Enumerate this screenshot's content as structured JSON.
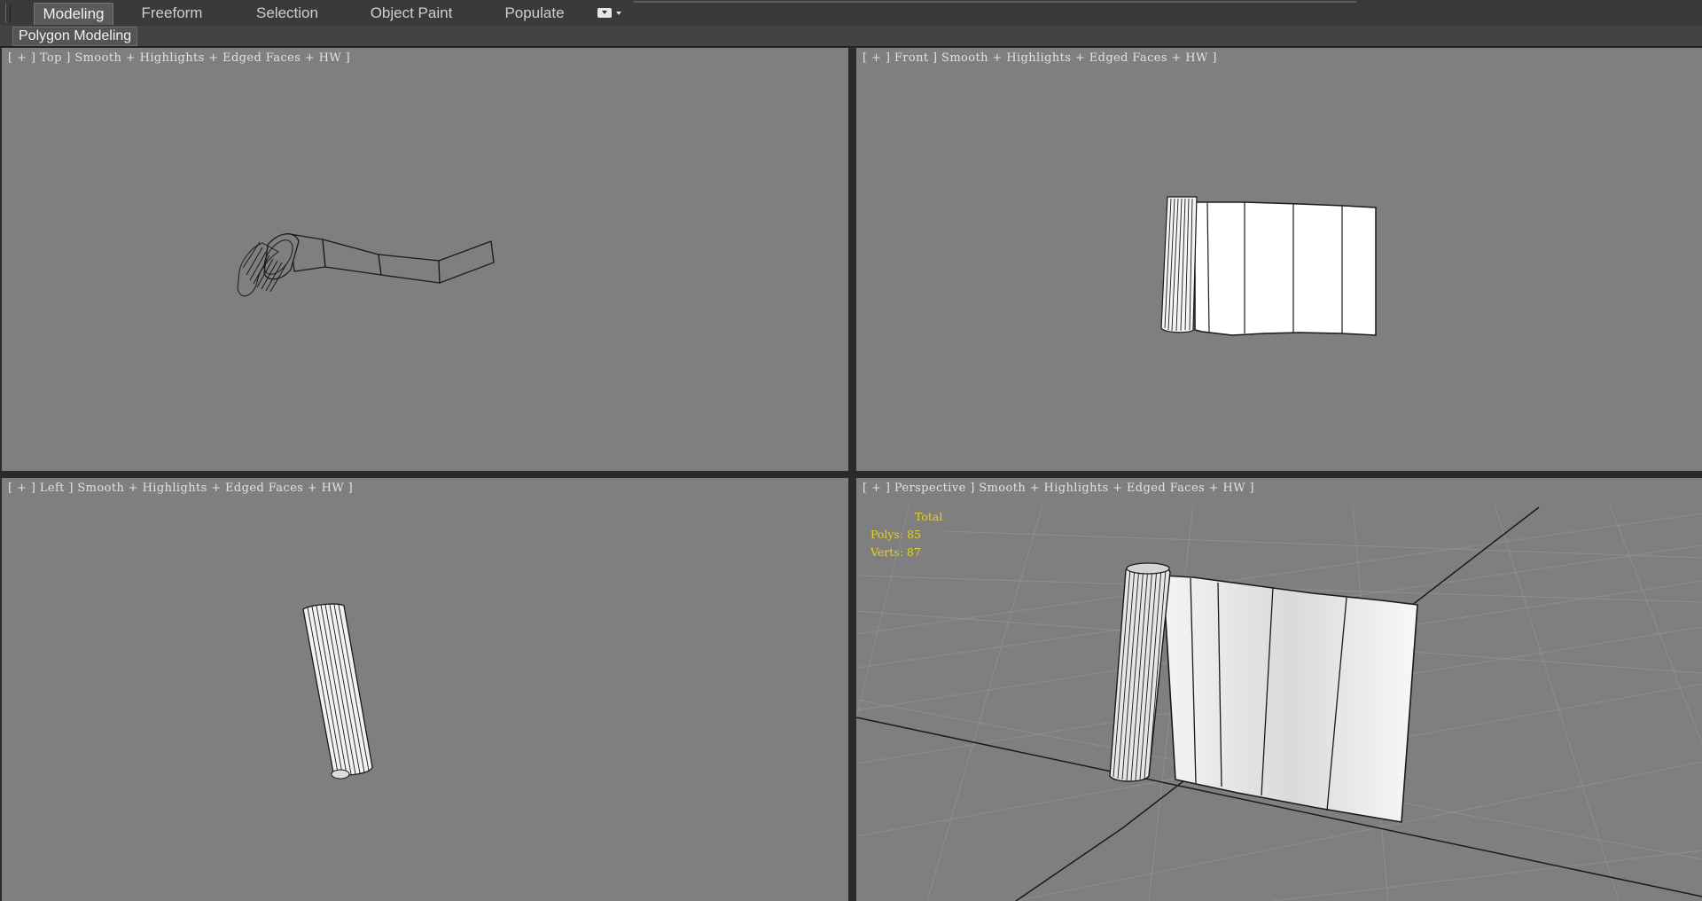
{
  "ribbon": {
    "tabs": [
      {
        "label": "Modeling",
        "active": true
      },
      {
        "label": "Freeform",
        "active": false
      },
      {
        "label": "Selection",
        "active": false
      },
      {
        "label": "Object Paint",
        "active": false
      },
      {
        "label": "Populate",
        "active": false
      }
    ],
    "options_icon": "ribbon-options-icon",
    "panel_label": "Polygon Modeling"
  },
  "viewports": {
    "top": {
      "label": "[ + ] Top ] Smooth + Highlights + Edged Faces + HW ]"
    },
    "front": {
      "label": "[ + ] Front ] Smooth + Highlights + Edged Faces + HW ]"
    },
    "left": {
      "label": "[ + ] Left ] Smooth + Highlights + Edged Faces + HW ]"
    },
    "persp": {
      "label": "[ + ] Perspective ] Smooth + Highlights + Edged Faces + HW ]"
    }
  },
  "stats": {
    "header": "Total",
    "polys": "Polys: 85",
    "verts": "Verts: 87"
  },
  "colors": {
    "viewport_bg": "#7f7f7f",
    "stats_text": "#e8d21a",
    "ui_dark": "#3a3a3a"
  }
}
